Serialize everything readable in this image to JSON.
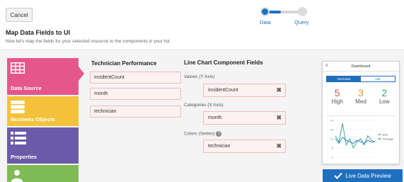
{
  "header": {
    "cancel_label": "Cancel",
    "steps": [
      {
        "label": "Data",
        "state": "active"
      },
      {
        "label": "Query",
        "state": "inactive"
      }
    ]
  },
  "page": {
    "title": "Map Data Fields to UI",
    "subtitle": "Now let's map the fields for your selected resource to the components in your list."
  },
  "categories": [
    {
      "label": "Data Source",
      "icon": "table-icon",
      "color": "#e5578b",
      "selected": true
    },
    {
      "label": "Business Objects",
      "icon": "database-icon",
      "color": "#f3c23a"
    },
    {
      "label": "Properties",
      "icon": "list-icon",
      "color": "#6a5ba8"
    },
    {
      "label": "",
      "icon": "user-icon",
      "color": "#7fbb55"
    }
  ],
  "resource": {
    "title": "Technician Performance",
    "fields": [
      "incidentCount",
      "month",
      "technician"
    ]
  },
  "component": {
    "title": "Line Chart Component Fields",
    "mappings": [
      {
        "caption": "Values (Y Axis)",
        "value": "incidentCount",
        "help": false
      },
      {
        "caption": "Categories (X Axis)",
        "value": "month",
        "help": false
      },
      {
        "caption": "Colors (Series)",
        "value": "technician",
        "help": true
      }
    ],
    "help_symbol": "?",
    "remove_symbol": "✖"
  },
  "preview": {
    "menu_symbol": "≡",
    "header": "Dashboard",
    "tabs": [
      {
        "label": "Overview",
        "active": true
      },
      {
        "label": "List",
        "active": false
      }
    ],
    "kpis": [
      {
        "value": "5",
        "label": "High",
        "color": "#e05555"
      },
      {
        "value": "3",
        "label": "Med",
        "color": "#e89a2c"
      },
      {
        "value": "2",
        "label": "Low",
        "color": "#3aa57b"
      }
    ],
    "button_label": "Live Data Preview",
    "chart_data": {
      "type": "line",
      "x": [
        1,
        2,
        3,
        4,
        5,
        6,
        7,
        8,
        9,
        10,
        11,
        12
      ],
      "series": [
        {
          "name": "Bob",
          "color": "#2a9d8f",
          "values": [
            14,
            10,
            22,
            8,
            12,
            6,
            10,
            12,
            8,
            14,
            11,
            10
          ]
        },
        {
          "name": "Average",
          "color": "#1f6fbf",
          "values": [
            12,
            9,
            13,
            11,
            10,
            9,
            11,
            10,
            9,
            11,
            10,
            10
          ]
        }
      ],
      "yticks": [
        "24",
        "18",
        "12",
        "6",
        "0"
      ],
      "ylim": [
        0,
        24
      ]
    }
  }
}
